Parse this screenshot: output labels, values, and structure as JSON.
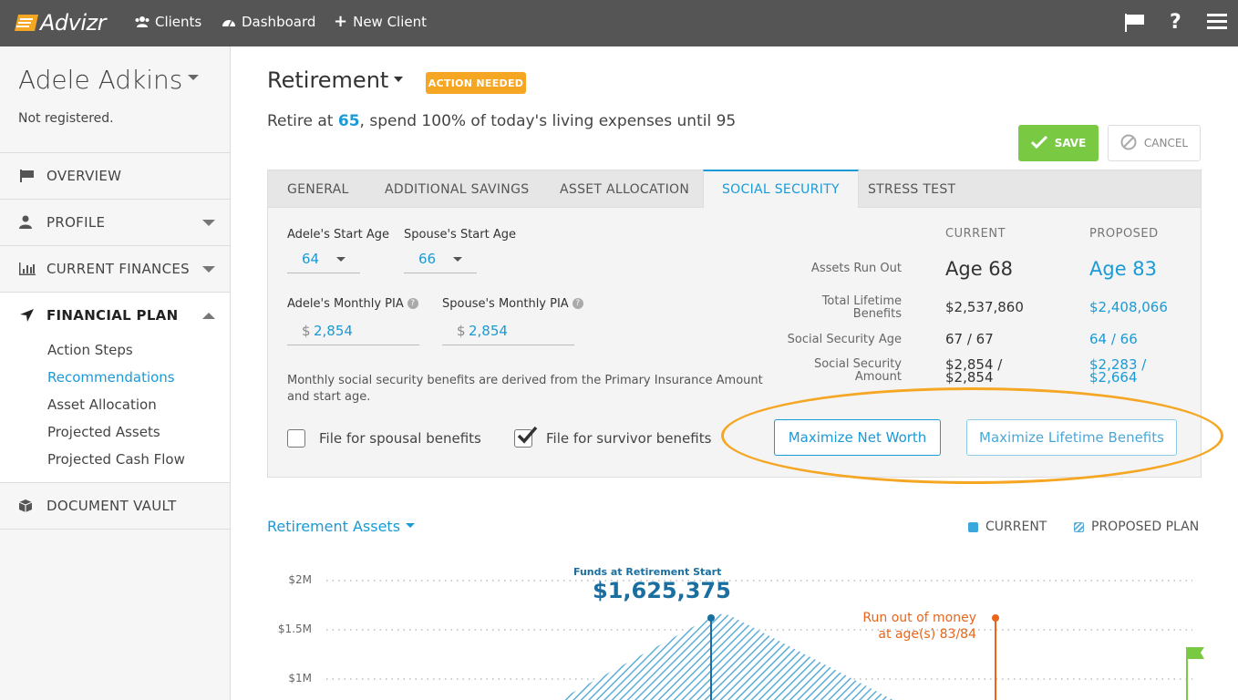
{
  "app": {
    "name": "Advizr",
    "nav": [
      "Clients",
      "Dashboard",
      "New Client"
    ]
  },
  "sidebar": {
    "client_name": "Adele Adkins",
    "client_status": "Not registered.",
    "items": [
      {
        "label": "OVERVIEW"
      },
      {
        "label": "PROFILE"
      },
      {
        "label": "CURRENT FINANCES"
      },
      {
        "label": "FINANCIAL PLAN"
      },
      {
        "label": "DOCUMENT VAULT"
      }
    ],
    "sub_items": [
      "Action Steps",
      "Recommendations",
      "Asset Allocation",
      "Projected Assets",
      "Projected Cash Flow"
    ]
  },
  "page": {
    "title": "Retirement",
    "badge": "ACTION NEEDED",
    "subtitle_pre": "Retire at ",
    "subtitle_age": "65",
    "subtitle_post": ", spend 100% of today's living expenses until 95",
    "save_label": "SAVE",
    "cancel_label": "CANCEL"
  },
  "tabs": [
    "GENERAL",
    "ADDITIONAL SAVINGS",
    "ASSET ALLOCATION",
    "SOCIAL SECURITY",
    "STRESS TEST"
  ],
  "form": {
    "adele_start_age_label": "Adele's Start Age",
    "adele_start_age": "64",
    "spouse_start_age_label": "Spouse's Start Age",
    "spouse_start_age": "66",
    "adele_pia_label": "Adele's Monthly PIA",
    "adele_pia": "2,854",
    "spouse_pia_label": "Spouse's Monthly PIA",
    "spouse_pia": "2,854",
    "currency": "$",
    "note": "Monthly social security benefits are derived from the Primary Insurance Amount and start age.",
    "spousal_label": "File for spousal benefits",
    "spousal_checked": false,
    "survivor_label": "File for survivor benefits",
    "survivor_checked": true
  },
  "comparison": {
    "current_header": "CURRENT",
    "proposed_header": "PROPOSED",
    "rows": [
      {
        "label": "Assets Run Out",
        "current": "Age 68",
        "proposed": "Age 83"
      },
      {
        "label": "Total Lifetime Benefits",
        "current": "$2,537,860",
        "proposed": "$2,408,066"
      },
      {
        "label": "Social Security Age",
        "current": "67 / 67",
        "proposed": "64 / 66"
      },
      {
        "label": "Social Security Amount",
        "current": "$2,854 / $2,854",
        "proposed": "$2,283 / $2,664"
      }
    ],
    "btn_net_worth": "Maximize Net Worth",
    "btn_lifetime": "Maximize Lifetime Benefits"
  },
  "chart_section": {
    "title": "Retirement Assets",
    "legend_current": "CURRENT",
    "legend_proposed": "PROPOSED PLAN",
    "current_color": "#3aa8dc",
    "proposed_color": "#5aaed8",
    "retire_label": "Funds at Retirement Start",
    "retire_value": "$1,625,375",
    "runout_label_1": "Run out of money",
    "runout_label_2": "at age(s) 83/84"
  },
  "chart_data": {
    "type": "area",
    "title": "Retirement Assets",
    "yticks": [
      "$2M",
      "$1.5M",
      "$1M"
    ],
    "series": [
      {
        "name": "PROPOSED PLAN"
      }
    ],
    "annotations": [
      {
        "text": "Funds at Retirement Start",
        "value": "$1,625,375"
      },
      {
        "text": "Run out of money at age(s) 83/84"
      }
    ]
  }
}
